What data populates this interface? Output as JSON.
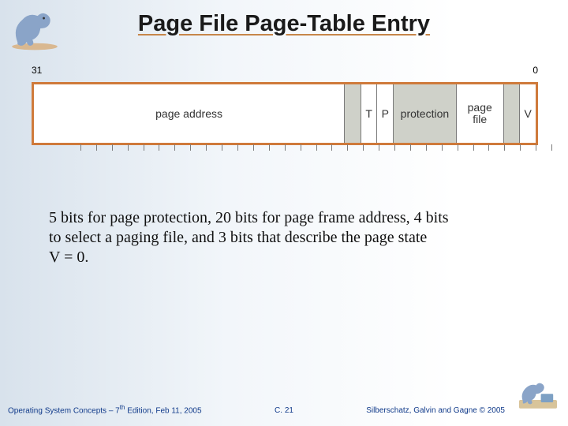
{
  "title": "Page File Page-Table Entry",
  "bits": {
    "high": "31",
    "low": "0"
  },
  "fields": {
    "page_address": "page address",
    "t": "T",
    "p": "P",
    "protection": "protection",
    "page_file": "page\nfile",
    "v": "V"
  },
  "body_text": "5 bits for page protection, 20 bits for page frame address, 4 bits to select a paging file, and 3 bits that describe the page state",
  "v_equals": "V = 0.",
  "footer": {
    "left_a": "Operating System Concepts – 7",
    "left_sup": "th",
    "left_b": " Edition, Feb 11, 2005",
    "mid": "C. 21",
    "right": "Silberschatz, Galvin and Gagne © 2005"
  }
}
